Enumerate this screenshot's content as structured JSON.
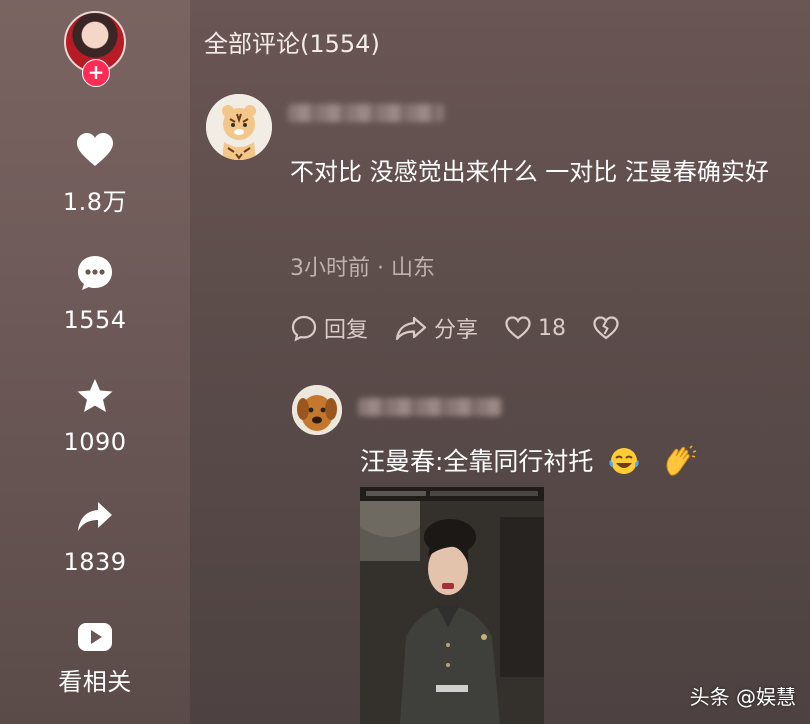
{
  "sidebar": {
    "likes": "1.8万",
    "comments": "1554",
    "favorites": "1090",
    "shares": "1839",
    "related": "看相关"
  },
  "comments_title": "全部评论(1554)",
  "comment1": {
    "text": "不对比 没感觉出来什么 一对比 汪曼春确实好",
    "meta": "3小时前 · 山东",
    "reply_label": "回复",
    "share_label": "分享",
    "like_count": "18"
  },
  "reply1": {
    "text": "汪曼春:全靠同行衬托"
  },
  "watermark": "头条 @娱慧",
  "colors": {
    "follow_badge": "#fe2c55"
  }
}
